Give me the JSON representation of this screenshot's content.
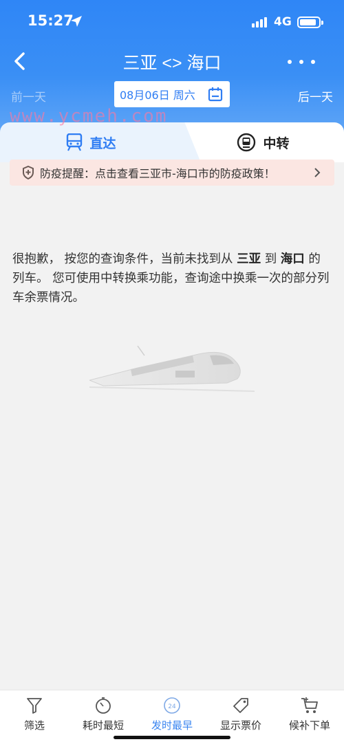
{
  "status_bar": {
    "time": "15:27",
    "network": "4G"
  },
  "header": {
    "title": "三亚 <> 海口",
    "prev_day": "前一天",
    "next_day": "后一天",
    "date": "08月06日 周六"
  },
  "watermark": "www.ycmeh.com",
  "tabs": [
    {
      "label": "直达",
      "active": true
    },
    {
      "label": "中转",
      "active": false
    }
  ],
  "notice": {
    "text": "防疫提醒：点击查看三亚市-海口市的防疫政策！"
  },
  "message": {
    "part1": "很抱歉， 按您的查询条件，当前未找到从 ",
    "from": "三亚",
    "part2": " 到 ",
    "to": "海口",
    "part3": " 的列车。 您可使用中转换乘功能，查询途中换乘一次的部分列车余票情况。"
  },
  "bottom_bar": [
    {
      "label": "筛选",
      "icon": "filter-icon"
    },
    {
      "label": "耗时最短",
      "icon": "timer-icon"
    },
    {
      "label": "发时最早",
      "icon": "clock-24-icon",
      "active": true
    },
    {
      "label": "显示票价",
      "icon": "price-tag-icon"
    },
    {
      "label": "候补下单",
      "icon": "cart-plus-icon"
    }
  ],
  "colors": {
    "accent": "#2f7df3",
    "header": "#3a8ff5",
    "notice_bg": "#fbe6e2"
  }
}
